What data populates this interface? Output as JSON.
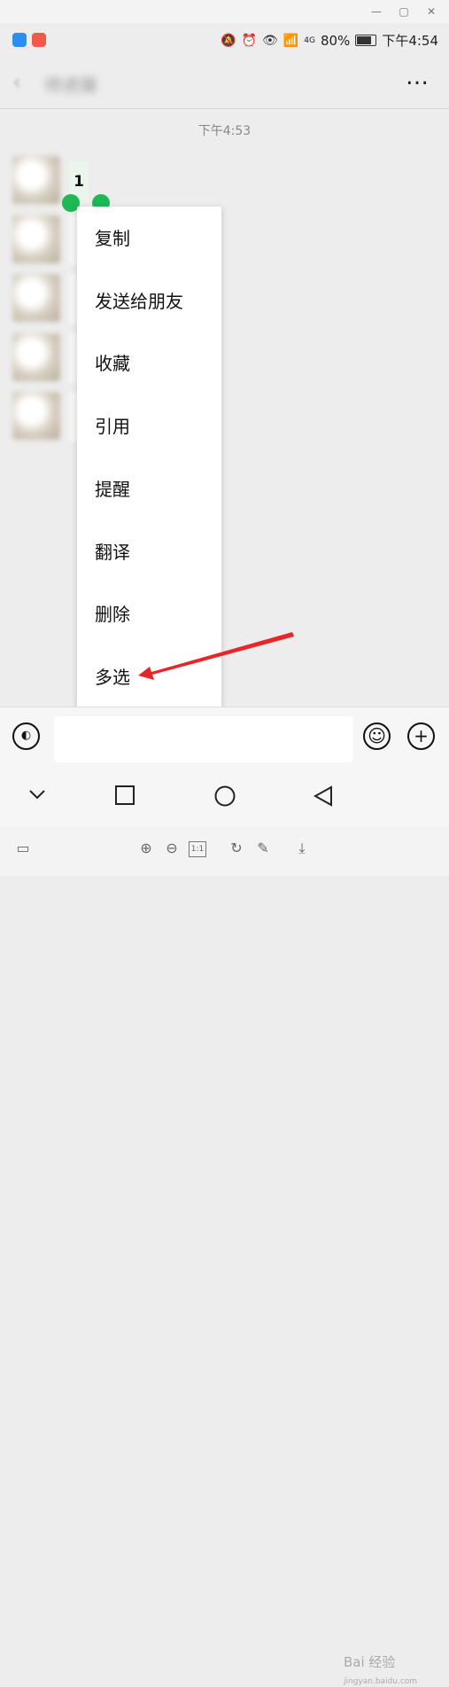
{
  "window": {
    "minimize_icon": "minimize-icon",
    "maximize_icon": "maximize-icon",
    "close_icon": "close-icon"
  },
  "status_bar": {
    "network": "4G",
    "battery": "80%",
    "time": "下午4:54"
  },
  "header": {
    "title": "待进展",
    "more_label": "…"
  },
  "chat": {
    "timestamp": "下午4:53",
    "first_message": "1"
  },
  "context_menu": {
    "items": [
      "复制",
      "发送给朋友",
      "收藏",
      "引用",
      "提醒",
      "翻译",
      "删除",
      "多选"
    ]
  },
  "input_bar": {
    "value": "",
    "placeholder": ""
  },
  "watermark": {
    "text": "Bai 经验",
    "sub": "jingyan.baidu.com"
  },
  "colors": {
    "accent_green": "#1eb854",
    "arrow_red": "#e8262a",
    "background": "#ededed"
  }
}
